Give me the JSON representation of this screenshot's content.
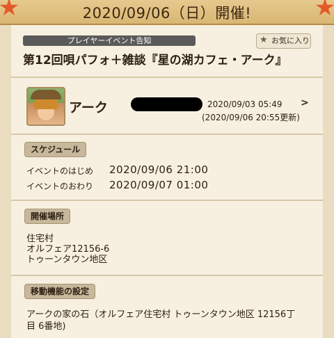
{
  "header": {
    "title": "2020/09/06（日）開催!"
  },
  "category_label": "プレイヤーイベント告知",
  "favorite_button": {
    "label": "お気に入り",
    "icon": "star-icon"
  },
  "event_title": "第12回唄パフォ＋雑談『星の湖カフェ・アーク』",
  "author": {
    "name": "アーク",
    "posted": "2020/09/03 05:49",
    "updated": "(2020/09/06 20:55更新)"
  },
  "schedule": {
    "section_title": "スケジュール",
    "start_label": "イベントのはじめ",
    "start_value": "2020/09/06 21:00",
    "end_label": "イベントのおわり",
    "end_value": "2020/09/07 01:00"
  },
  "venue": {
    "section_title": "開催場所",
    "line1": "住宅村",
    "line2": "オルフェア12156-6",
    "line3": "トゥーンタウン地区"
  },
  "travel": {
    "section_title": "移動機能の設定",
    "line1": "アークの家の石（オルフェア住宅村 トゥーンタウン地区 12156丁",
    "line2": "目 6番地)"
  }
}
